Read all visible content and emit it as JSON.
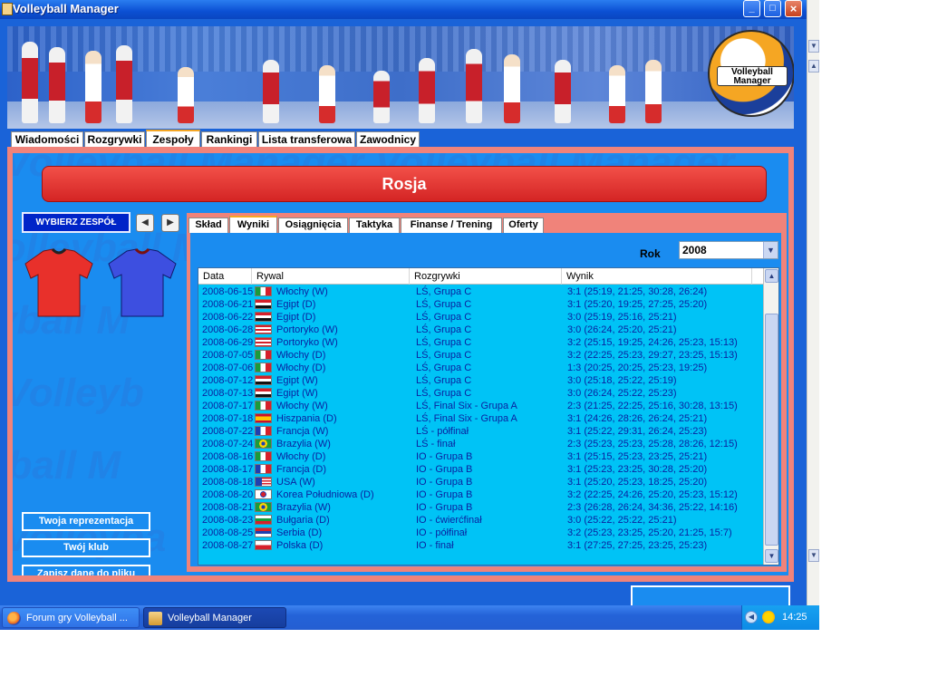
{
  "window": {
    "title": "Volleyball Manager"
  },
  "logo": {
    "text": "Volleyball Manager"
  },
  "top_tabs": [
    {
      "label": "Wiadomości"
    },
    {
      "label": "Rozgrywki"
    },
    {
      "label": "Zespoły"
    },
    {
      "label": "Rankingi"
    },
    {
      "label": "Lista transferowa"
    },
    {
      "label": "Zawodnicy"
    }
  ],
  "team": {
    "name": "Rosja",
    "select_label": "WYBIERZ ZESPÓŁ",
    "home_shirt_color": "#e8302b",
    "away_shirt_color": "#3d4fe0"
  },
  "side_buttons": {
    "national": "Twoja reprezentacja",
    "club": "Twój klub",
    "save": "Zapisz dane do pliku"
  },
  "sub_tabs": [
    {
      "label": "Skład"
    },
    {
      "label": "Wyniki"
    },
    {
      "label": "Osiągnięcia"
    },
    {
      "label": "Taktyka"
    },
    {
      "label": "Finanse / Trening"
    },
    {
      "label": "Oferty"
    }
  ],
  "results": {
    "year_label": "Rok",
    "year": "2008",
    "headers": {
      "date": "Data",
      "opponent": "Rywal",
      "competition": "Rozgrywki",
      "result": "Wynik"
    },
    "rows": [
      {
        "date": "2008-06-15",
        "flag": "italy",
        "opponent": "Włochy (W)",
        "competition": "LŚ, Grupa C",
        "result": "3:1 (25:19, 21:25, 30:28, 26:24)"
      },
      {
        "date": "2008-06-21",
        "flag": "egypt",
        "opponent": "Egipt (D)",
        "competition": "LŚ, Grupa C",
        "result": "3:1 (25:20, 19:25, 27:25, 25:20)"
      },
      {
        "date": "2008-06-22",
        "flag": "egypt",
        "opponent": "Egipt (D)",
        "competition": "LŚ, Grupa C",
        "result": "3:0 (25:19, 25:16, 25:21)"
      },
      {
        "date": "2008-06-28",
        "flag": "puerto-rico",
        "opponent": "Portoryko (W)",
        "competition": "LŚ, Grupa C",
        "result": "3:0 (26:24, 25:20, 25:21)"
      },
      {
        "date": "2008-06-29",
        "flag": "puerto-rico",
        "opponent": "Portoryko (W)",
        "competition": "LŚ, Grupa C",
        "result": "3:2 (25:15, 19:25, 24:26, 25:23, 15:13)"
      },
      {
        "date": "2008-07-05",
        "flag": "italy",
        "opponent": "Włochy (D)",
        "competition": "LŚ, Grupa C",
        "result": "3:2 (22:25, 25:23, 29:27, 23:25, 15:13)"
      },
      {
        "date": "2008-07-06",
        "flag": "italy",
        "opponent": "Włochy (D)",
        "competition": "LŚ, Grupa C",
        "result": "1:3 (20:25, 20:25, 25:23, 19:25)"
      },
      {
        "date": "2008-07-12",
        "flag": "egypt",
        "opponent": "Egipt (W)",
        "competition": "LŚ, Grupa C",
        "result": "3:0 (25:18, 25:22, 25:19)"
      },
      {
        "date": "2008-07-13",
        "flag": "egypt",
        "opponent": "Egipt (W)",
        "competition": "LŚ, Grupa C",
        "result": "3:0 (26:24, 25:22, 25:23)"
      },
      {
        "date": "2008-07-17",
        "flag": "italy",
        "opponent": "Włochy (W)",
        "competition": "LŚ, Final Six - Grupa A",
        "result": "2:3 (21:25, 22:25, 25:16, 30:28, 13:15)"
      },
      {
        "date": "2008-07-18",
        "flag": "spain",
        "opponent": "Hiszpania (D)",
        "competition": "LŚ, Final Six - Grupa A",
        "result": "3:1 (24:26, 28:26, 26:24, 25:21)"
      },
      {
        "date": "2008-07-22",
        "flag": "france",
        "opponent": "Francja (W)",
        "competition": "LŚ - półfinał",
        "result": "3:1 (25:22, 29:31, 26:24, 25:23)"
      },
      {
        "date": "2008-07-24",
        "flag": "brazil",
        "opponent": "Brazylia (W)",
        "competition": "LŚ - finał",
        "result": "2:3 (25:23, 25:23, 25:28, 28:26, 12:15)"
      },
      {
        "date": "2008-08-16",
        "flag": "italy",
        "opponent": "Włochy (D)",
        "competition": "IO - Grupa B",
        "result": "3:1 (25:15, 25:23, 23:25, 25:21)"
      },
      {
        "date": "2008-08-17",
        "flag": "france",
        "opponent": "Francja (D)",
        "competition": "IO - Grupa B",
        "result": "3:1 (25:23, 23:25, 30:28, 25:20)"
      },
      {
        "date": "2008-08-18",
        "flag": "usa",
        "opponent": "USA (W)",
        "competition": "IO - Grupa B",
        "result": "3:1 (25:20, 25:23, 18:25, 25:20)"
      },
      {
        "date": "2008-08-20",
        "flag": "korea",
        "opponent": "Korea Południowa (D)",
        "competition": "IO - Grupa B",
        "result": "3:2 (22:25, 24:26, 25:20, 25:23, 15:12)"
      },
      {
        "date": "2008-08-21",
        "flag": "brazil",
        "opponent": "Brazylia (W)",
        "competition": "IO - Grupa B",
        "result": "2:3 (26:28, 26:24, 34:36, 25:22, 14:16)"
      },
      {
        "date": "2008-08-23",
        "flag": "bulgaria",
        "opponent": "Bułgaria (D)",
        "competition": "IO - ćwierćfinał",
        "result": "3:0 (25:22, 25:22, 25:21)"
      },
      {
        "date": "2008-08-25",
        "flag": "serbia",
        "opponent": "Serbia (D)",
        "competition": "IO - półfinał",
        "result": "3:2 (25:23, 23:25, 25:20, 21:25, 15:7)"
      },
      {
        "date": "2008-08-27",
        "flag": "poland",
        "opponent": "Polska (D)",
        "competition": "IO - finał",
        "result": "3:1 (27:25, 27:25, 23:25, 25:23)"
      }
    ]
  },
  "taskbar": {
    "tasks": [
      {
        "label": "Forum gry Volleyball ..."
      },
      {
        "label": "Volleyball Manager"
      }
    ],
    "clock": "14:25"
  }
}
